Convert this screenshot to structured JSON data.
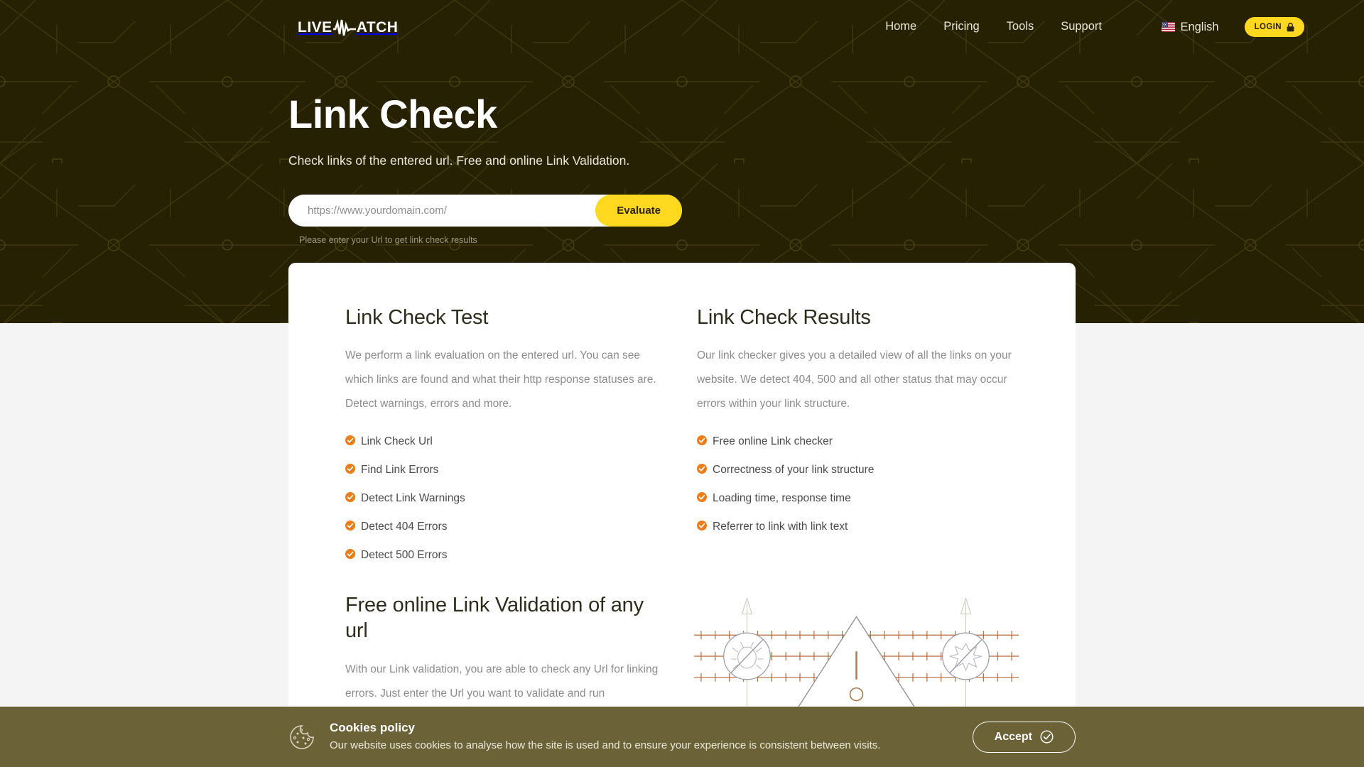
{
  "brand": {
    "name_left": "LIVE",
    "name_right": "ATCH",
    "icon": "pulse-wave-icon",
    "accent": "#ffd81f"
  },
  "nav": {
    "links": [
      {
        "label": "Home"
      },
      {
        "label": "Pricing"
      },
      {
        "label": "Tools"
      },
      {
        "label": "Support"
      }
    ],
    "language": {
      "label": "English",
      "flag": "us-flag-icon"
    },
    "login": {
      "label": "LOGIN",
      "icon": "lock-icon"
    }
  },
  "hero": {
    "title": "Link Check",
    "subtitle": "Check links of the entered url. Free and online Link Validation.",
    "search": {
      "placeholder": "https://www.yourdomain.com/",
      "value": "",
      "button_label": "Evaluate",
      "hint": "Please enter your Url to get link check results"
    },
    "background_color": "#272103"
  },
  "card": {
    "left": {
      "heading": "Link Check Test",
      "paragraph": "We perform a link evaluation on the entered url. You can see which links are found and what their http response statuses are. Detect warnings, errors and more.",
      "features": [
        "Link Check Url",
        "Find Link Errors",
        "Detect Link Warnings",
        "Detect 404 Errors",
        "Detect 500 Errors"
      ]
    },
    "right": {
      "heading": "Link Check Results",
      "paragraph": "Our link checker gives you a detailed view of all the links on your website. We detect 404, 500 and all other status that may occur errors within your link structure.",
      "features": [
        "Free online Link checker",
        "Correctness of your link structure",
        "Loading time, response time",
        "Referrer to link with link text"
      ]
    },
    "check_icon_color": "#ed7d18"
  },
  "lower": {
    "heading": "Free online Link Validation of any url",
    "paragraph": "With our Link validation, you are able to check any Url for linking errors. Just enter the Url you want to validate and run",
    "illustration": "broken-link-warning-illustration"
  },
  "cookies": {
    "icon": "cookie-icon",
    "title": "Cookies policy",
    "text": "Our website uses cookies to analyse how the site is used and to ensure your experience is consistent between visits.",
    "accept_label": "Accept",
    "accept_icon": "check-circle-icon",
    "background_color": "#6b6237"
  }
}
